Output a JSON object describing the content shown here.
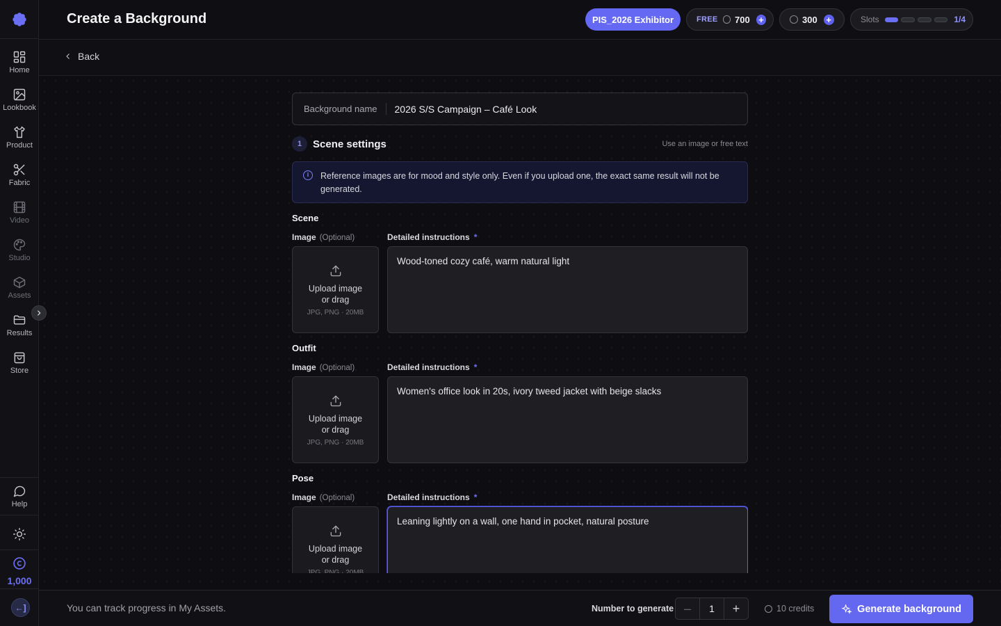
{
  "header": {
    "title": "Create a Background",
    "exhibitor_label": "PIS_2026 Exhibitor",
    "free_tag": "FREE",
    "free_credits": "700",
    "credits": "300",
    "slots_label": "Slots",
    "slots_count": "1/4",
    "slots_used_fraction": 0.25
  },
  "back": {
    "label": "Back"
  },
  "sidebar": {
    "items": [
      {
        "label": "Home",
        "icon": "grid-icon"
      },
      {
        "label": "Lookbook",
        "icon": "image-icon"
      },
      {
        "label": "Product",
        "icon": "shirt-icon"
      },
      {
        "label": "Fabric",
        "icon": "scissors-icon"
      },
      {
        "label": "Video",
        "icon": "film-icon"
      },
      {
        "label": "Studio",
        "icon": "palette-icon"
      },
      {
        "label": "Assets",
        "icon": "box-icon"
      },
      {
        "label": "Results",
        "icon": "folder-icon"
      },
      {
        "label": "Store",
        "icon": "bag-icon"
      }
    ],
    "help_label": "Help",
    "credits": "1,000",
    "avatar_initial": "←]"
  },
  "form": {
    "name_label": "Background name",
    "name_value": "2026 S/S Campaign – Café Look",
    "step_number": "1",
    "step_title": "Scene settings",
    "step_hint": "Use an image or free text",
    "info_text": "Reference images are for mood and style only. Even if you upload one, the exact same result will not be generated.",
    "image_label": "Image",
    "optional_label": "(Optional)",
    "instructions_label": "Detailed instructions",
    "required_mark": "*",
    "upload_text": "Upload image or drag",
    "upload_meta": "JPG, PNG · 20MB",
    "sections": [
      {
        "title": "Scene",
        "instructions": "Wood-toned cozy café, warm natural light"
      },
      {
        "title": "Outfit",
        "instructions": "Women's office look in 20s, ivory tweed jacket with beige slacks"
      },
      {
        "title": "Pose",
        "instructions": "Leaning lightly on a wall, one hand in pocket, natural posture"
      }
    ]
  },
  "footer": {
    "message": "You can track progress in My Assets.",
    "number_label": "Number to generate",
    "minus": "–",
    "plus": "+",
    "count": "1",
    "cost": "10 credits",
    "generate_label": "Generate background"
  },
  "colors": {
    "accent": "#6467f0",
    "background": "#0e0e12"
  }
}
